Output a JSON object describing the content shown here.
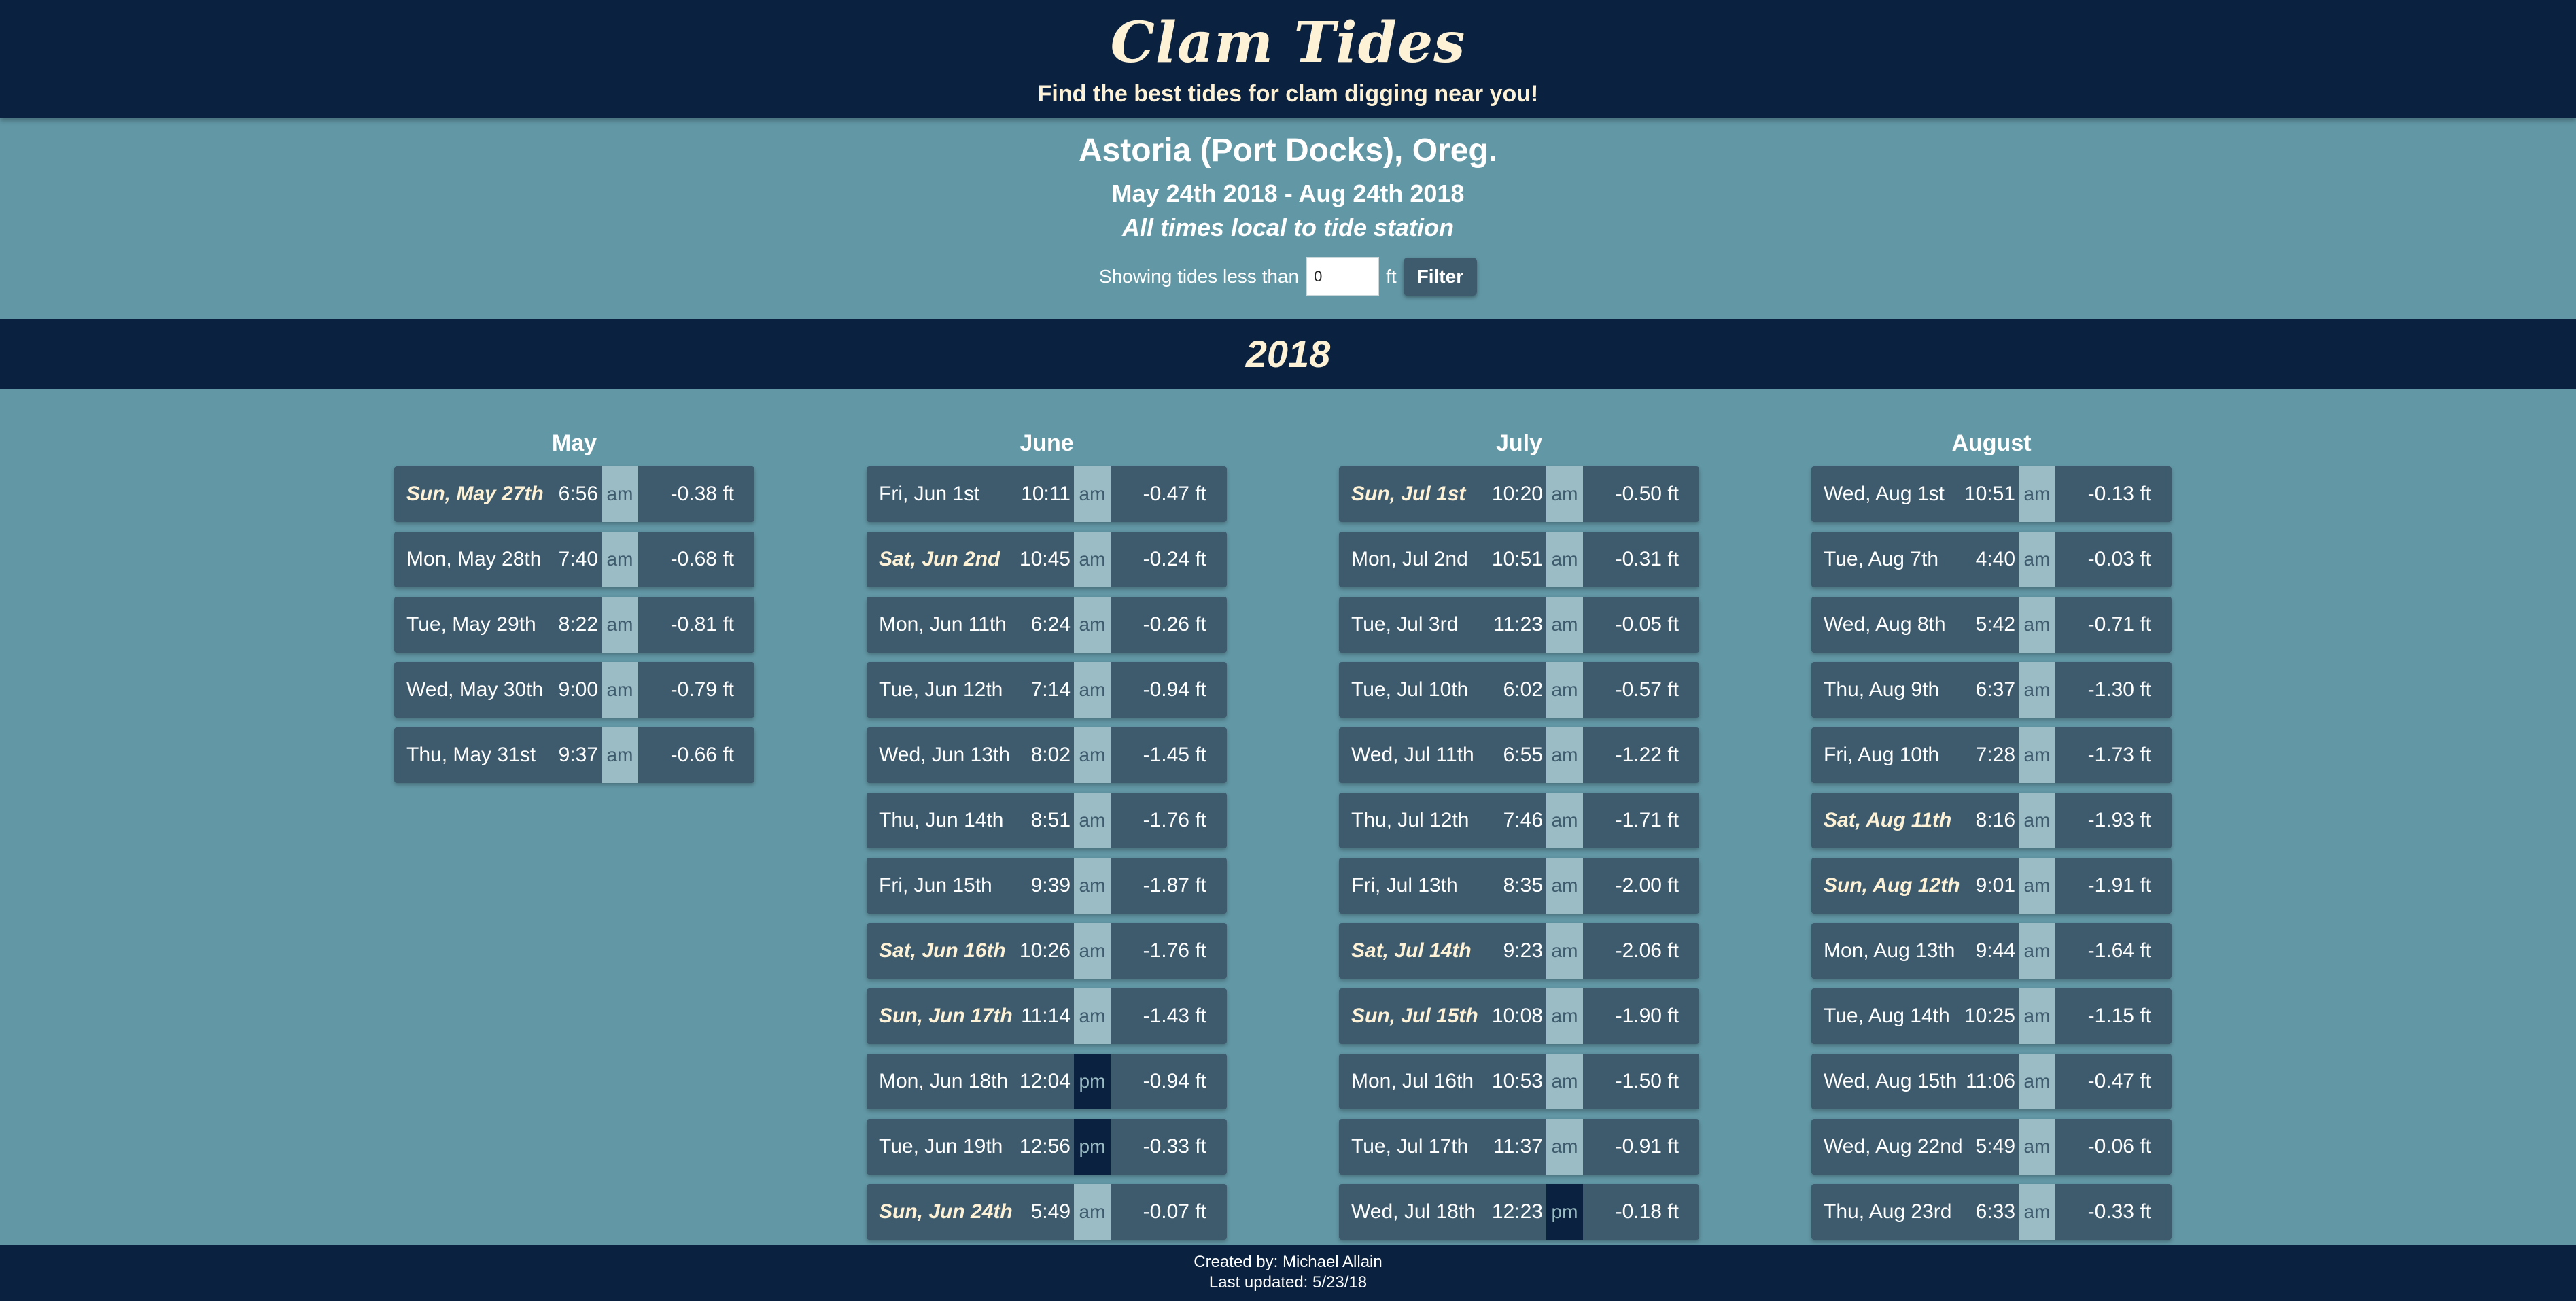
{
  "header": {
    "title": "Clam Tides",
    "tagline": "Find the best tides for clam digging near you!"
  },
  "station": {
    "name": "Astoria (Port Docks), Oreg.",
    "date_range": "May 24th 2018 - Aug 24th 2018",
    "note": "All times local to tide station"
  },
  "filter": {
    "label": "Showing tides less than",
    "value": "0",
    "unit": "ft",
    "button": "Filter"
  },
  "year": "2018",
  "months": [
    {
      "name": "May",
      "rows": [
        {
          "date": "Sun, May 27th",
          "weekend": true,
          "time": "6:56",
          "ampm": "am",
          "height": "-0.38 ft"
        },
        {
          "date": "Mon, May 28th",
          "weekend": false,
          "time": "7:40",
          "ampm": "am",
          "height": "-0.68 ft"
        },
        {
          "date": "Tue, May 29th",
          "weekend": false,
          "time": "8:22",
          "ampm": "am",
          "height": "-0.81 ft"
        },
        {
          "date": "Wed, May 30th",
          "weekend": false,
          "time": "9:00",
          "ampm": "am",
          "height": "-0.79 ft"
        },
        {
          "date": "Thu, May 31st",
          "weekend": false,
          "time": "9:37",
          "ampm": "am",
          "height": "-0.66 ft"
        }
      ]
    },
    {
      "name": "June",
      "rows": [
        {
          "date": "Fri, Jun 1st",
          "weekend": false,
          "time": "10:11",
          "ampm": "am",
          "height": "-0.47 ft"
        },
        {
          "date": "Sat, Jun 2nd",
          "weekend": true,
          "time": "10:45",
          "ampm": "am",
          "height": "-0.24 ft"
        },
        {
          "date": "Mon, Jun 11th",
          "weekend": false,
          "time": "6:24",
          "ampm": "am",
          "height": "-0.26 ft"
        },
        {
          "date": "Tue, Jun 12th",
          "weekend": false,
          "time": "7:14",
          "ampm": "am",
          "height": "-0.94 ft"
        },
        {
          "date": "Wed, Jun 13th",
          "weekend": false,
          "time": "8:02",
          "ampm": "am",
          "height": "-1.45 ft"
        },
        {
          "date": "Thu, Jun 14th",
          "weekend": false,
          "time": "8:51",
          "ampm": "am",
          "height": "-1.76 ft"
        },
        {
          "date": "Fri, Jun 15th",
          "weekend": false,
          "time": "9:39",
          "ampm": "am",
          "height": "-1.87 ft"
        },
        {
          "date": "Sat, Jun 16th",
          "weekend": true,
          "time": "10:26",
          "ampm": "am",
          "height": "-1.76 ft"
        },
        {
          "date": "Sun, Jun 17th",
          "weekend": true,
          "time": "11:14",
          "ampm": "am",
          "height": "-1.43 ft"
        },
        {
          "date": "Mon, Jun 18th",
          "weekend": false,
          "time": "12:04",
          "ampm": "pm",
          "height": "-0.94 ft"
        },
        {
          "date": "Tue, Jun 19th",
          "weekend": false,
          "time": "12:56",
          "ampm": "pm",
          "height": "-0.33 ft"
        },
        {
          "date": "Sun, Jun 24th",
          "weekend": true,
          "time": "5:49",
          "ampm": "am",
          "height": "-0.07 ft"
        }
      ]
    },
    {
      "name": "July",
      "rows": [
        {
          "date": "Sun, Jul 1st",
          "weekend": true,
          "time": "10:20",
          "ampm": "am",
          "height": "-0.50 ft"
        },
        {
          "date": "Mon, Jul 2nd",
          "weekend": false,
          "time": "10:51",
          "ampm": "am",
          "height": "-0.31 ft"
        },
        {
          "date": "Tue, Jul 3rd",
          "weekend": false,
          "time": "11:23",
          "ampm": "am",
          "height": "-0.05 ft"
        },
        {
          "date": "Tue, Jul 10th",
          "weekend": false,
          "time": "6:02",
          "ampm": "am",
          "height": "-0.57 ft"
        },
        {
          "date": "Wed, Jul 11th",
          "weekend": false,
          "time": "6:55",
          "ampm": "am",
          "height": "-1.22 ft"
        },
        {
          "date": "Thu, Jul 12th",
          "weekend": false,
          "time": "7:46",
          "ampm": "am",
          "height": "-1.71 ft"
        },
        {
          "date": "Fri, Jul 13th",
          "weekend": false,
          "time": "8:35",
          "ampm": "am",
          "height": "-2.00 ft"
        },
        {
          "date": "Sat, Jul 14th",
          "weekend": true,
          "time": "9:23",
          "ampm": "am",
          "height": "-2.06 ft"
        },
        {
          "date": "Sun, Jul 15th",
          "weekend": true,
          "time": "10:08",
          "ampm": "am",
          "height": "-1.90 ft"
        },
        {
          "date": "Mon, Jul 16th",
          "weekend": false,
          "time": "10:53",
          "ampm": "am",
          "height": "-1.50 ft"
        },
        {
          "date": "Tue, Jul 17th",
          "weekend": false,
          "time": "11:37",
          "ampm": "am",
          "height": "-0.91 ft"
        },
        {
          "date": "Wed, Jul 18th",
          "weekend": false,
          "time": "12:23",
          "ampm": "pm",
          "height": "-0.18 ft"
        }
      ]
    },
    {
      "name": "August",
      "rows": [
        {
          "date": "Wed, Aug 1st",
          "weekend": false,
          "time": "10:51",
          "ampm": "am",
          "height": "-0.13 ft"
        },
        {
          "date": "Tue, Aug 7th",
          "weekend": false,
          "time": "4:40",
          "ampm": "am",
          "height": "-0.03 ft"
        },
        {
          "date": "Wed, Aug 8th",
          "weekend": false,
          "time": "5:42",
          "ampm": "am",
          "height": "-0.71 ft"
        },
        {
          "date": "Thu, Aug 9th",
          "weekend": false,
          "time": "6:37",
          "ampm": "am",
          "height": "-1.30 ft"
        },
        {
          "date": "Fri, Aug 10th",
          "weekend": false,
          "time": "7:28",
          "ampm": "am",
          "height": "-1.73 ft"
        },
        {
          "date": "Sat, Aug 11th",
          "weekend": true,
          "time": "8:16",
          "ampm": "am",
          "height": "-1.93 ft"
        },
        {
          "date": "Sun, Aug 12th",
          "weekend": true,
          "time": "9:01",
          "ampm": "am",
          "height": "-1.91 ft"
        },
        {
          "date": "Mon, Aug 13th",
          "weekend": false,
          "time": "9:44",
          "ampm": "am",
          "height": "-1.64 ft"
        },
        {
          "date": "Tue, Aug 14th",
          "weekend": false,
          "time": "10:25",
          "ampm": "am",
          "height": "-1.15 ft"
        },
        {
          "date": "Wed, Aug 15th",
          "weekend": false,
          "time": "11:06",
          "ampm": "am",
          "height": "-0.47 ft"
        },
        {
          "date": "Wed, Aug 22nd",
          "weekend": false,
          "time": "5:49",
          "ampm": "am",
          "height": "-0.06 ft"
        },
        {
          "date": "Thu, Aug 23rd",
          "weekend": false,
          "time": "6:33",
          "ampm": "am",
          "height": "-0.33 ft"
        }
      ]
    }
  ],
  "footer": {
    "created_by": "Created by: Michael Allain",
    "last_updated": "Last updated: 5/23/18"
  },
  "colors": {
    "navy": "#0a2240",
    "teal_background": "#6297a5",
    "row": "#3e5b6e",
    "cream": "#fdf1d6",
    "am_chip": "#9bbcc4"
  }
}
